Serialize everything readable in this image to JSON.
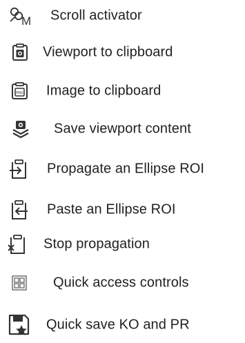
{
  "menu": {
    "items": [
      {
        "label": "Scroll activator",
        "icon": "scroll-activator-icon"
      },
      {
        "label": "Viewport to clipboard",
        "icon": "viewport-clipboard-icon"
      },
      {
        "label": "Image to clipboard",
        "icon": "image-clipboard-icon"
      },
      {
        "label": "Save viewport content",
        "icon": "save-viewport-icon"
      },
      {
        "label": "Propagate an Ellipse ROI",
        "icon": "propagate-roi-icon"
      },
      {
        "label": "Paste an Ellipse ROI",
        "icon": "paste-roi-icon"
      },
      {
        "label": "Stop propagation",
        "icon": "stop-propagation-icon"
      },
      {
        "label": "Quick access controls",
        "icon": "quick-access-grid-icon"
      },
      {
        "label": "Quick save KO and PR",
        "icon": "quick-save-icon"
      }
    ]
  }
}
